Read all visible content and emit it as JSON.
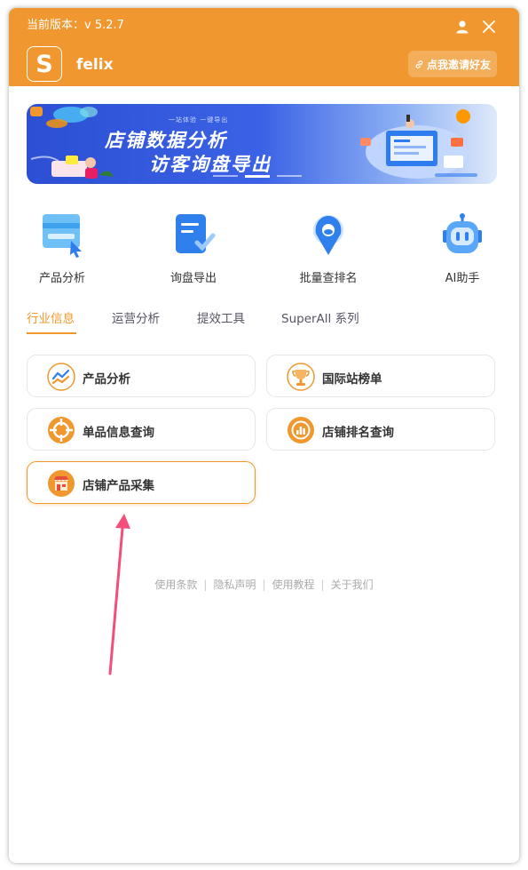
{
  "header": {
    "version_text": "当前版本：v 5.2.7",
    "logo_letter": "S",
    "username": "felix",
    "invite_label": "点我邀请好友"
  },
  "banner": {
    "small_text": "一站体验 一键导出",
    "title_line1": "店铺数据分析",
    "title_line2": "访客询盘导出",
    "slide_count": 3,
    "active_slide": 2
  },
  "features": [
    {
      "label": "产品分析",
      "icon": "product-analysis-icon"
    },
    {
      "label": "询盘导出",
      "icon": "inquiry-export-icon"
    },
    {
      "label": "批量查排名",
      "icon": "batch-ranking-icon"
    },
    {
      "label": "AI助手",
      "icon": "ai-robot-icon"
    }
  ],
  "tabs": [
    {
      "label": "行业信息",
      "active": true
    },
    {
      "label": "运营分析",
      "active": false
    },
    {
      "label": "提效工具",
      "active": false
    },
    {
      "label": "SuperAll 系列",
      "active": false
    }
  ],
  "cards": [
    {
      "label": "产品分析",
      "icon": "trend-chart-icon"
    },
    {
      "label": "国际站榜单",
      "icon": "trophy-icon"
    },
    {
      "label": "单品信息查询",
      "icon": "crosshair-icon"
    },
    {
      "label": "店铺排名查询",
      "icon": "bar-chart-icon"
    },
    {
      "label": "店铺产品采集",
      "icon": "store-icon",
      "highlighted": true
    }
  ],
  "footer": {
    "links": [
      "使用条款",
      "隐私声明",
      "使用教程",
      "关于我们"
    ]
  },
  "colors": {
    "brand": "#f0982f",
    "annotation_arrow": "#f2507b"
  }
}
